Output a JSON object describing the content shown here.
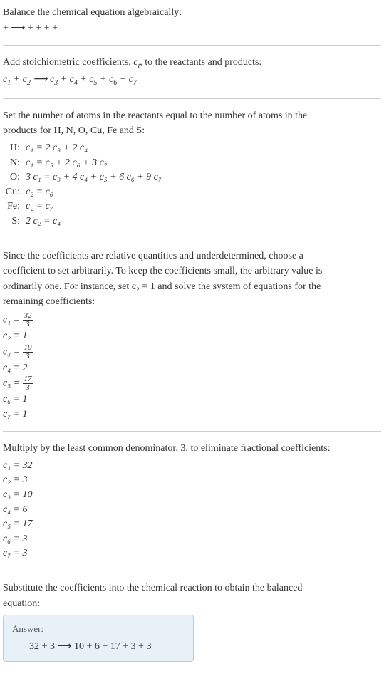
{
  "intro1": "Balance the chemical equation algebraically:",
  "intro2": " +  ⟶  +  +  +  + ",
  "stoich_heading": "Add stoichiometric coefficients, ",
  "stoich_var": "c",
  "stoich_sub": "i",
  "stoich_tail": ", to the reactants and products:",
  "stoich_eq_parts": [
    "c",
    "1",
    " + c",
    "2",
    "  ⟶ c",
    "3",
    "  + c",
    "4",
    "  + c",
    "5",
    "  + c",
    "6",
    "  + c",
    "7"
  ],
  "atoms_heading1": "Set the number of atoms in the reactants equal to the number of atoms in the",
  "atoms_heading2": "products for H, N, O, Cu, Fe and S:",
  "equations": [
    {
      "label": "H:",
      "body": "c₁ = 2 c₃ + 2 c₄"
    },
    {
      "label": "N:",
      "body": "c₁ = c₅ + 2 c₆ + 3 c₇"
    },
    {
      "label": "O:",
      "body": "3 c₁ = c₃ + 4 c₄ + c₅ + 6 c₆ + 9 c₇"
    },
    {
      "label": "Cu:",
      "body": "c₂ = c₆"
    },
    {
      "label": "Fe:",
      "body": "c₂ = c₇"
    },
    {
      "label": "S:",
      "body": "2 c₂ = c₄"
    }
  ],
  "underdet1": "Since the coefficients are relative quantities and underdetermined, choose a",
  "underdet2": "coefficient to set arbitrarily. To keep the coefficients small, the arbitrary value is",
  "underdet3": "ordinarily one. For instance, set c₂ = 1 and solve the system of equations for the",
  "underdet4": "remaining coefficients:",
  "coeffs_frac": [
    {
      "lhs": "c₁ = ",
      "num": "32",
      "den": "3"
    },
    {
      "lhs": "c₂ = 1",
      "num": "",
      "den": ""
    },
    {
      "lhs": "c₃ = ",
      "num": "10",
      "den": "3"
    },
    {
      "lhs": "c₄ = 2",
      "num": "",
      "den": ""
    },
    {
      "lhs": "c₅ = ",
      "num": "17",
      "den": "3"
    },
    {
      "lhs": "c₆ = 1",
      "num": "",
      "den": ""
    },
    {
      "lhs": "c₇ = 1",
      "num": "",
      "den": ""
    }
  ],
  "mult_heading": "Multiply by the least common denominator, 3, to eliminate fractional coefficients:",
  "coeffs_int": [
    "c₁ = 32",
    "c₂ = 3",
    "c₃ = 10",
    "c₄ = 6",
    "c₅ = 17",
    "c₆ = 3",
    "c₇ = 3"
  ],
  "subst1": "Substitute the coefficients into the chemical reaction to obtain the balanced",
  "subst2": "equation:",
  "answer_label": "Answer:",
  "answer_eq": "32  + 3  ⟶ 10  + 6  + 17  + 3  + 3"
}
